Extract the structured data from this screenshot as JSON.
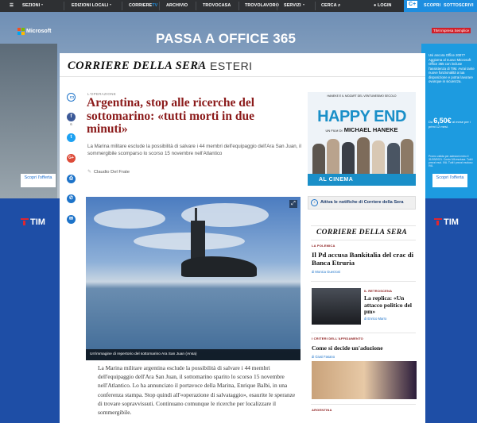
{
  "nav": {
    "items": [
      "SEZIONI",
      "EDIZIONI LOCALI",
      "CORRIERE",
      "ARCHIVIO",
      "TROVOCASA",
      "TROVOLAVORO",
      "SERVIZI",
      "CERCA",
      "LOGIN",
      "SCOPRI",
      "SOTTOSCRIVI"
    ],
    "corriere_tv_suffix": "TV",
    "cplus_logo": "C+"
  },
  "ad": {
    "title": "PASSA A OFFICE 365",
    "brand": "Microsoft",
    "tim_tag": "TIM Impresa Semplice",
    "right_text": "Usi ancora Office 2007? Aggiorna al nuovo Microsoft Office 365 con incluse l'assistenza di TIM. Avrai tante nuove funzionalità a tua disposizione e potrai lavorare ovunque in sicurezza.",
    "price_prefix": "Da",
    "price": "6,50€",
    "price_suffix": "al mese per i primi 12 mesi.",
    "fine_print": "Promo valida per adesioni entro il 31/03/2021. Costo IVA esclusa. Tutti i prezzi escl. IVA. Tutti i prezzi escluso IVA.",
    "cta_left": "Scopri l'offerta",
    "cta_right": "Scopri l'offerta",
    "tim_left": "TIM",
    "tim_right": "TIM"
  },
  "masthead": {
    "logo": "CORRIERE DELLA SERA",
    "slash": "/",
    "section": "ESTERI"
  },
  "share": {
    "fb_count": "6"
  },
  "article": {
    "kicker": "L'OPERAZIONE",
    "headline": "Argentina, stop alle ricerche del sottomarino: «tutti morti in due minuti»",
    "summary": "La Marina militare esclude la possibilità di salvare i 44 membri dell'equipaggio dell'Ara San Juan, il sommergibile scomparso lo scorso 15 novembre nell'Atlantico",
    "byline": "Claudio Del Frate",
    "photo_caption": "Un'immagine di repertorio del sottomarino Ara San Juan (Ansa)",
    "body": "La Marina militare argentina esclude la possibilità di salvare i 44 membri dell'equipaggio dell'Ara San Juan, il sottomarino sparito lo scorso 15 novembre nell'Atlantico. Lo ha annunciato il portavoce della Marina, Enrique Balbi, in una conferenza stampa. Stop quindi all'«operazione di salvataggio», esaurite le speranze di trovare sopravvissuti. Continuano comunque le ricerche per localizzare il sommergibile."
  },
  "sidebar": {
    "film": {
      "header": "HANEKE E IL MOZART DEL VENTUNESIMO SECOLO",
      "title": "HAPPY END",
      "director_prefix": "UN FILM DI",
      "director": "MICHAEL HANEKE",
      "cinema": "AL CINEMA"
    },
    "notif": "Attiva le notifiche di Corriere della Sera",
    "logo": "CORRIERE DELLA SERA",
    "stories": [
      {
        "kicker": "LA POLEMICA",
        "title": "Il Pd accusa Bankitalia del crac di Banca Etruria",
        "author": "di Monica Guerzoni"
      },
      {
        "kicker": "IL RETROSCENA",
        "title": "La replica: «Un attacco politico del pm»",
        "author": "di Enrico Marro"
      },
      {
        "kicker": "I CRITERI DELL'AFFIDAMENTO",
        "title": "Come si decide un'adozione",
        "author": "di Giusi Fasano"
      },
      {
        "kicker": "ARGENTINA"
      }
    ]
  },
  "colors": {
    "headline": "#8b1a1a",
    "nav_bg": "#2e3033",
    "cplus_bg": "#1d8ee0",
    "tim_blue": "#1e4ea6",
    "film_blue": "#1a8fc8"
  }
}
